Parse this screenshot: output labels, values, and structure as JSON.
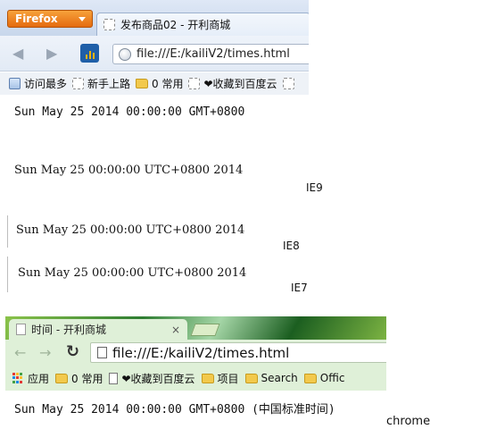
{
  "firefox": {
    "menu_button": "Firefox",
    "tab_title": "发布商品02 - 开利商城",
    "url": "file:///E:/kailiV2/times.html",
    "bookmarks": [
      "访问最多",
      "新手上路",
      "0 常用",
      "❤收藏到百度云"
    ]
  },
  "outputs": {
    "firefox_date": "Sun May 25 2014 00:00:00 GMT+0800",
    "ie9_date": "Sun May 25 00:00:00 UTC+0800 2014",
    "ie9_label": "IE9",
    "ie8_date": "Sun May 25 00:00:00 UTC+0800 2014",
    "ie8_label": "IE8",
    "ie7_date": "Sun May 25 00:00:00 UTC+0800 2014",
    "ie7_label": "IE7",
    "chrome_date": "Sun May 25 2014 00:00:00 GMT+0800 (中国标准时间)",
    "chrome_label": "chrome"
  },
  "chrome": {
    "tab_title": "时间 - 开利商城",
    "tab_close": "×",
    "url": "file:///E:/kailiV2/times.html",
    "bookmarks": [
      "应用",
      "0 常用",
      "❤收藏到百度云",
      "项目",
      "Search",
      "Offic"
    ]
  },
  "colors": {
    "firefox_orange": "#e56b0f",
    "chrome_green": "#dff0d8"
  }
}
